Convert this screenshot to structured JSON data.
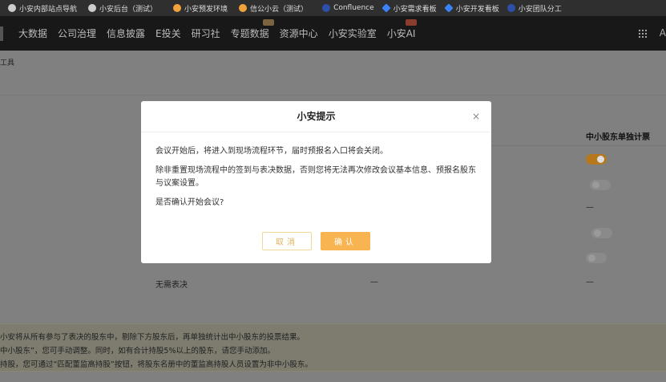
{
  "bookmarks": [
    {
      "label": "小安内部站点导航",
      "color": "#cccccc"
    },
    {
      "label": "小安后台（测试）",
      "color": "#cccccc"
    },
    {
      "label": "小安预发环境",
      "color": "#f0a23c"
    },
    {
      "label": "信公小云（测试）",
      "color": "#f0a23c"
    },
    {
      "label": "Confluence",
      "color": "#2e4fa8"
    },
    {
      "label": "小安需求看板",
      "color": "#3b82f6"
    },
    {
      "label": "小安开发看板",
      "color": "#3b82f6"
    },
    {
      "label": "小安团队分工",
      "color": "#2e4fa8"
    }
  ],
  "nav": {
    "items": [
      "大数据",
      "公司治理",
      "信息披露",
      "E投关",
      "研习社",
      "专题数据",
      "资源中心",
      "小安实验室",
      "小安AI"
    ],
    "user_initial": "A"
  },
  "breadcrumb": "工具",
  "table": {
    "column_header": "中小股东单独计票",
    "row_label": "无需表决",
    "dash": "—"
  },
  "notice": {
    "lines": [
      "小安将从所有参与了表决的股东中，剔除下方股东后，再单独统计出中小股东的投票结果。",
      "中小股东”，您可手动调整。同时，如有合计持股5%以上的股东，请您手动添加。",
      "持股，您可通过“匹配董监高持股”按钮，将股东名册中的董监高持股人员设置为非中小股东。"
    ]
  },
  "modal": {
    "title": "小安提示",
    "close": "×",
    "paragraphs": [
      "会议开始后，将进入到现场流程环节，届时预报名入口将会关闭。",
      "除非重置现场流程中的签到与表决数据，否则您将无法再次修改会议基本信息、预报名股东与议案设置。",
      "是否确认开始会议?"
    ],
    "cancel": "取消",
    "confirm": "确认"
  },
  "colors": {
    "accent": "#f7b451"
  }
}
